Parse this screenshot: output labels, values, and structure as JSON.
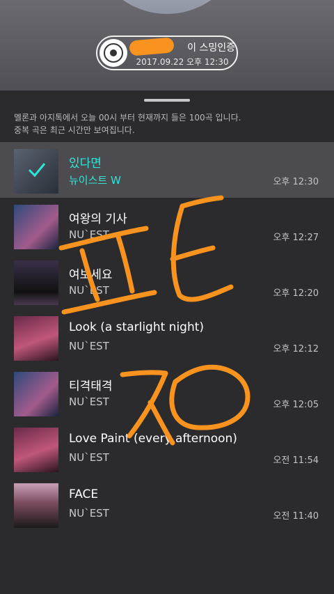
{
  "header": {
    "title_visible": "이 스밍인증",
    "date_time": "2017.09.22 오후 12:30",
    "icon": "disc-icon"
  },
  "notice": {
    "line1": "멜론과 아지톡에서 오늘 00시 부터 현재까지 들은 100곡 입니다.",
    "line2": "중복 곡은 최근 시간만 보여집니다."
  },
  "songs": [
    {
      "title": "있다면",
      "artist": "뉴이스트 W",
      "time": "오후 12:30"
    },
    {
      "title": "여왕의 기사",
      "artist": "NU`EST",
      "time": "오후 12:27"
    },
    {
      "title": "여보세요",
      "artist": "NU`EST",
      "time": "오후 12:20"
    },
    {
      "title": "Look (a starlight night)",
      "artist": "NU`EST",
      "time": "오후 12:12"
    },
    {
      "title": "티격태격",
      "artist": "NU`EST",
      "time": "오후 12:05"
    },
    {
      "title": "Love Paint (every afternoon)",
      "artist": "NU`EST",
      "time": "오전 11:54"
    },
    {
      "title": "FACE",
      "artist": "NU`EST",
      "time": "오전 11:40"
    }
  ],
  "colors": {
    "accent": "#2fe6d7",
    "scribble": "#f7931e"
  }
}
